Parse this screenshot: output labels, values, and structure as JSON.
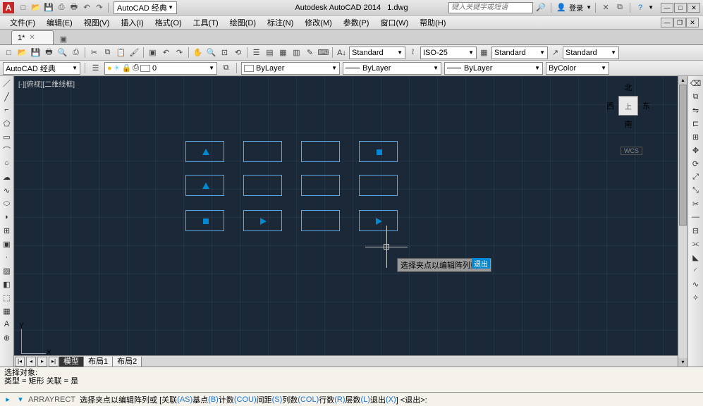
{
  "title": {
    "app": "Autodesk AutoCAD 2014",
    "file": "1.dwg"
  },
  "qat": {
    "logo": "A"
  },
  "workspace": {
    "label": "AutoCAD 经典"
  },
  "search": {
    "placeholder": "键入关键字或短语"
  },
  "signin": {
    "label": "登录"
  },
  "menus": [
    "文件(F)",
    "编辑(E)",
    "视图(V)",
    "插入(I)",
    "格式(O)",
    "工具(T)",
    "绘图(D)",
    "标注(N)",
    "修改(M)",
    "参数(P)",
    "窗口(W)",
    "帮助(H)"
  ],
  "filetab": {
    "name": "1*"
  },
  "styles": {
    "text": "Standard",
    "dim": "ISO-25",
    "table": "Standard",
    "mleader": "Standard"
  },
  "props": {
    "layer": "0",
    "color": "ByLayer",
    "ltype": "ByLayer",
    "lweight": "ByLayer",
    "plot": "ByColor"
  },
  "layer_combo": "AutoCAD 经典",
  "viewport_label": "[-][俯视][二维线框]",
  "viewcube": {
    "n": "北",
    "s": "南",
    "e": "东",
    "w": "西",
    "top": "上"
  },
  "wcs": "WCS",
  "ucs": {
    "x": "X",
    "y": "Y"
  },
  "model_tabs": [
    "模型",
    "布局1",
    "布局2"
  ],
  "dyn_prompt": "选择夹点以编辑阵列或",
  "dyn_exit": "退出",
  "cmd_history": {
    "l1": "选择对象:",
    "l2": "类型 = 矩形  关联 = 是"
  },
  "cmdline": {
    "name": "ARRAYRECT",
    "text": "选择夹点以编辑阵列或 [关联",
    "as": "(AS)",
    "t2": " 基点",
    "b": "(B)",
    "t3": " 计数",
    "cou": "(COU)",
    "t4": " 间距",
    "s": "(S)",
    "t5": " 列数",
    "col": "(COL)",
    "t6": " 行数",
    "r": "(R)",
    "t7": " 层数",
    "l": "(L)",
    "t8": " 退出",
    "x": "(X)",
    "t9": "] <退出>:"
  }
}
